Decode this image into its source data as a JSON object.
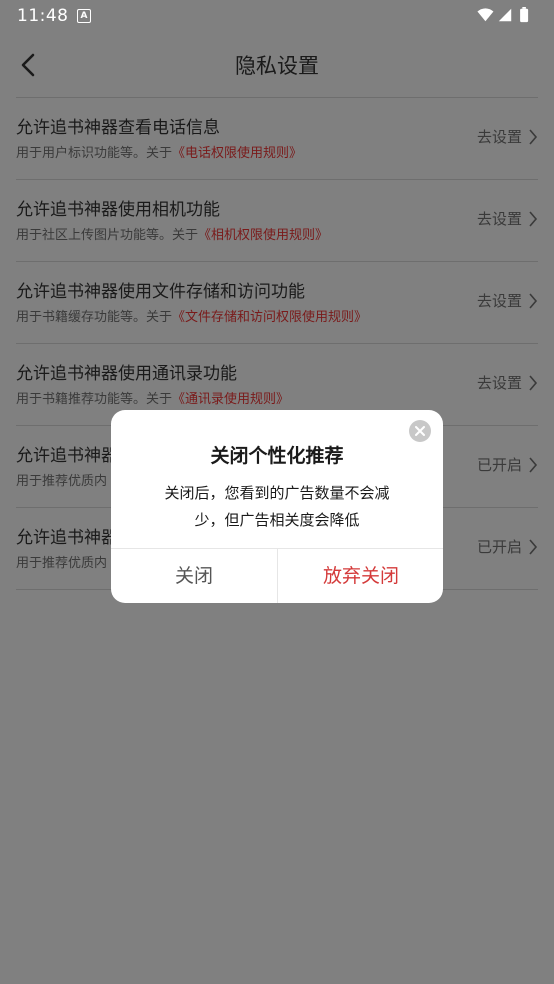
{
  "status_bar": {
    "time": "11:48",
    "notification_icon": "A"
  },
  "header": {
    "title": "隐私设置",
    "back_icon": "chevron-left-icon"
  },
  "settings": [
    {
      "label": "允许追书神器查看电话信息",
      "desc_prefix": "用于用户标识功能等。关于",
      "desc_link": "《电话权限使用规则》",
      "action": "去设置"
    },
    {
      "label": "允许追书神器使用相机功能",
      "desc_prefix": "用于社区上传图片功能等。关于",
      "desc_link": "《相机权限使用规则》",
      "action": "去设置"
    },
    {
      "label": "允许追书神器使用文件存储和访问功能",
      "desc_prefix": "用于书籍缓存功能等。关于",
      "desc_link": "《文件存储和访问权限使用规则》",
      "action": "去设置"
    },
    {
      "label": "允许追书神器使用通讯录功能",
      "desc_prefix": "用于书籍推荐功能等。关于",
      "desc_link": "《通讯录使用规则》",
      "action": "去设置"
    },
    {
      "label": "允许追书神器",
      "desc_prefix": "用于推荐优质内",
      "desc_link": "",
      "action": "已开启"
    },
    {
      "label": "允许追书神器",
      "desc_prefix": "用于推荐优质内",
      "desc_link": "",
      "action": "已开启"
    }
  ],
  "dialog": {
    "title": "关闭个性化推荐",
    "message": "关闭后，您看到的广告数量不会减少，但广告相关度会降低",
    "close_button": "关闭",
    "give_up_button": "放弃关闭"
  },
  "colors": {
    "overlay": "#808080",
    "accent": "#d43a3a",
    "link": "#7a1a1a"
  }
}
